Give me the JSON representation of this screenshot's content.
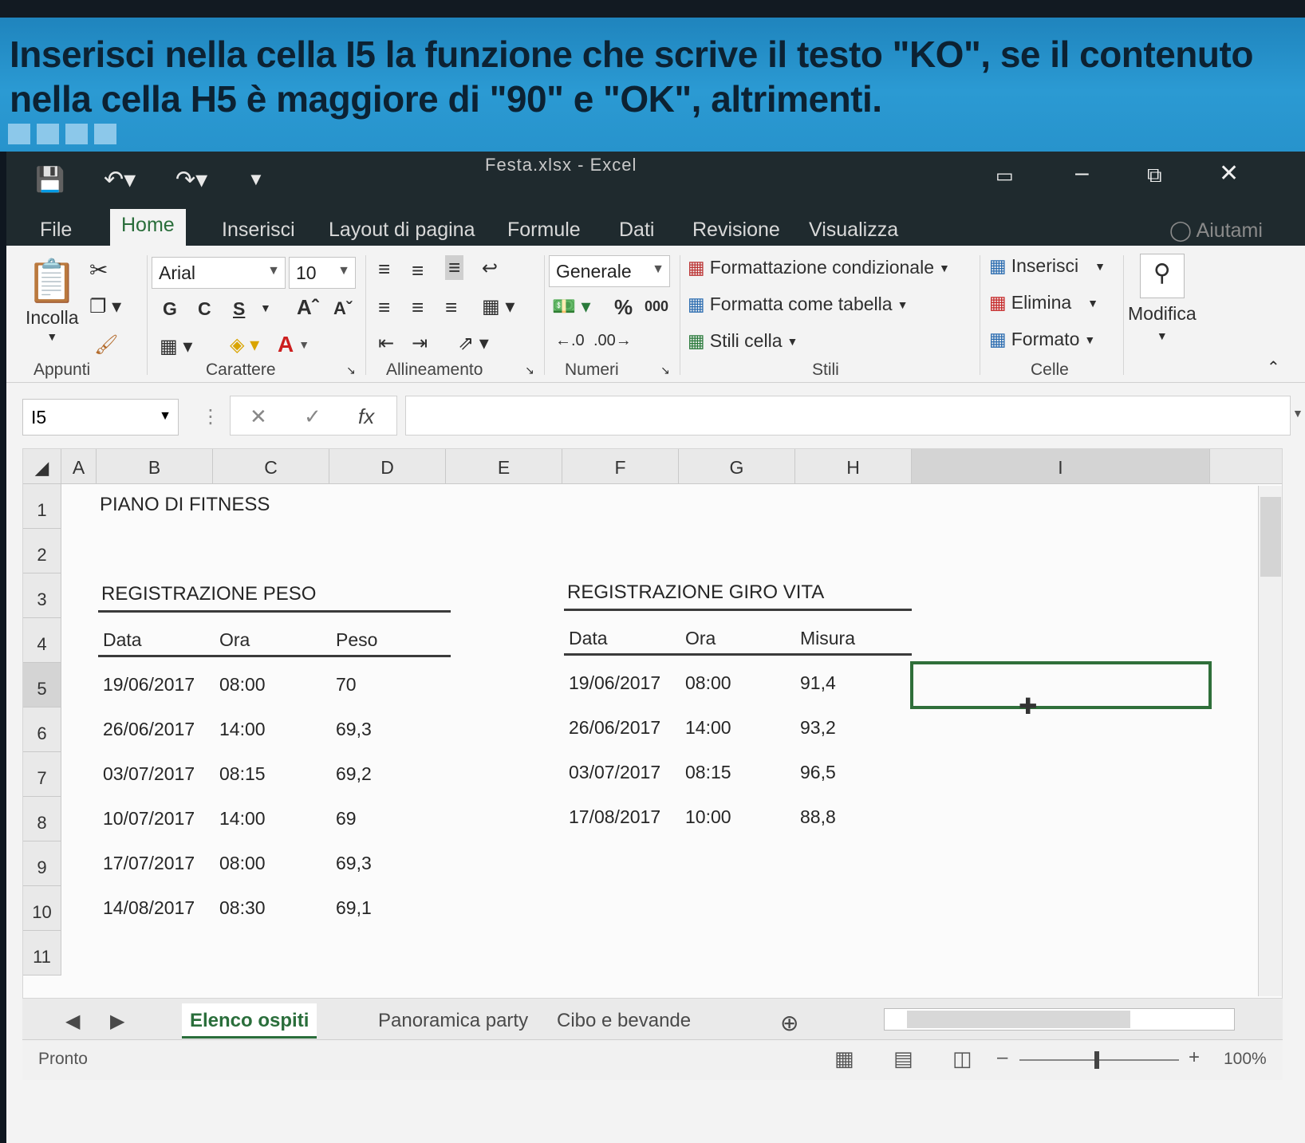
{
  "instruction": {
    "text": "Inserisci nella cella I5 la funzione che scrive il testo \"KO\", se il contenuto nella cella H5 è maggiore di \"90\" e \"OK\", altrimenti."
  },
  "window": {
    "title": "Festa.xlsx - Excel"
  },
  "tabs": [
    "File",
    "Home",
    "Inserisci",
    "Layout di pagina",
    "Formule",
    "Dati",
    "Revisione",
    "Visualizza"
  ],
  "help_label": "Aiutami",
  "ribbon": {
    "clipboard": {
      "paste_label": "Incolla",
      "group_label": "Appunti"
    },
    "font": {
      "family": "Arial",
      "size": "10",
      "bold": "G",
      "italic": "C",
      "underline": "S",
      "group_label": "Carattere"
    },
    "alignment": {
      "group_label": "Allineamento"
    },
    "numbers": {
      "format": "Generale",
      "percent": "%",
      "thousands": "000",
      "group_label": "Numeri"
    },
    "styles": {
      "conditional": "Formattazione condizionale",
      "as_table": "Formatta come tabella",
      "cell_styles": "Stili cella",
      "group_label": "Stili"
    },
    "cells": {
      "insert": "Inserisci",
      "delete": "Elimina",
      "format": "Formato",
      "group_label": "Celle"
    },
    "editing": {
      "label": "Modifica"
    }
  },
  "formula_bar": {
    "name_box": "I5",
    "fx": "fx",
    "value": ""
  },
  "columns": [
    "A",
    "B",
    "C",
    "D",
    "E",
    "F",
    "G",
    "H",
    "I"
  ],
  "rows": [
    "1",
    "2",
    "3",
    "4",
    "5",
    "6",
    "7",
    "8",
    "9",
    "10",
    "11"
  ],
  "sheet": {
    "title": "PIANO DI FITNESS",
    "peso": {
      "title": "REGISTRAZIONE PESO",
      "headers": [
        "Data",
        "Ora",
        "Peso"
      ],
      "rows": [
        [
          "19/06/2017",
          "08:00",
          "70"
        ],
        [
          "26/06/2017",
          "14:00",
          "69,3"
        ],
        [
          "03/07/2017",
          "08:15",
          "69,2"
        ],
        [
          "10/07/2017",
          "14:00",
          "69"
        ],
        [
          "17/07/2017",
          "08:00",
          "69,3"
        ],
        [
          "14/08/2017",
          "08:30",
          "69,1"
        ]
      ]
    },
    "vita": {
      "title": "REGISTRAZIONE GIRO VITA",
      "headers": [
        "Data",
        "Ora",
        "Misura"
      ],
      "rows": [
        [
          "19/06/2017",
          "08:00",
          "91,4"
        ],
        [
          "26/06/2017",
          "14:00",
          "93,2"
        ],
        [
          "03/07/2017",
          "08:15",
          "96,5"
        ],
        [
          "17/08/2017",
          "10:00",
          "88,8"
        ]
      ]
    }
  },
  "sheet_tabs": [
    "Elenco ospiti",
    "Panoramica party",
    "Cibo e bevande"
  ],
  "status": {
    "ready": "Pronto",
    "zoom": "100%"
  },
  "colors": {
    "accent": "#2a6e3b",
    "banner": "#2b9ad3"
  }
}
